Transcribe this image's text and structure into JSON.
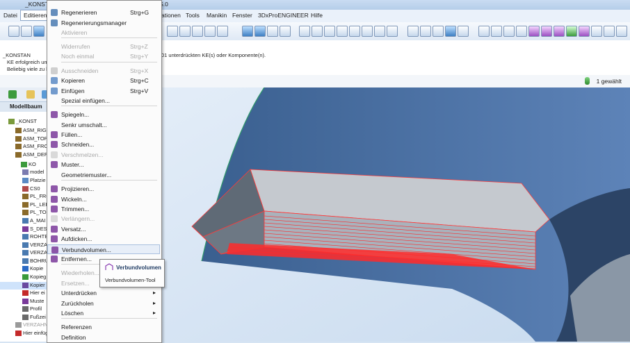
{
  "window": {
    "title": "_KONST",
    "title_suffix": "5.0"
  },
  "menubar": {
    "items": [
      "Datei",
      "Editieren",
      "ationen",
      "Tools",
      "Manikin",
      "Fenster",
      "3DxProENGINEER",
      "Hilfe"
    ]
  },
  "messages": {
    "line1_prefix": "_KONSTAN",
    "line1_suffix": "01 unterdrückten KE(s) oder Komponente(n).",
    "line2": "KE erfolgreich umd",
    "line3": "Beliebig viele zu ko"
  },
  "status": {
    "selected": "1 gewählt"
  },
  "model_tree": {
    "title": "Modellbaum",
    "rows": [
      "_KONST",
      "ASM_RIGH",
      "ASM_TOP",
      "ASM_FROI",
      "ASM_DEF_",
      "KO",
      "model",
      "Platzie",
      "CS0",
      "PL_FRO",
      "PL_LEF",
      "PL_TO",
      "A_MAI",
      "S_DESI",
      "ROHTE",
      "VERZA",
      "VERZA",
      "BOHRU",
      "Kopie",
      "Kopieg",
      "Kopier",
      "Hier ei",
      "Muste",
      "Profil",
      "Fußzei",
      "VERZAHN",
      "Hier einfüg"
    ]
  },
  "edit_menu": {
    "items": [
      {
        "label": "Regenerieren",
        "shortcut": "Strg+G",
        "disabled": false
      },
      {
        "label": "Regenerierungsmanager",
        "shortcut": "",
        "disabled": false
      },
      {
        "label": "Aktivieren",
        "shortcut": "",
        "disabled": true
      },
      {
        "label": "Widerrufen",
        "shortcut": "Strg+Z",
        "disabled": true
      },
      {
        "label": "Noch einmal",
        "shortcut": "Strg+Y",
        "disabled": true
      },
      {
        "label": "Ausschneiden",
        "shortcut": "Strg+X",
        "disabled": true
      },
      {
        "label": "Kopieren",
        "shortcut": "Strg+C",
        "disabled": false
      },
      {
        "label": "Einfügen",
        "shortcut": "Strg+V",
        "disabled": false
      },
      {
        "label": "Spezial einfügen...",
        "shortcut": "",
        "disabled": false
      },
      {
        "label": "Spiegeln...",
        "shortcut": "",
        "disabled": false
      },
      {
        "label": "Senkr umschalt...",
        "shortcut": "",
        "disabled": false
      },
      {
        "label": "Füllen...",
        "shortcut": "",
        "disabled": false
      },
      {
        "label": "Schneiden...",
        "shortcut": "",
        "disabled": false
      },
      {
        "label": "Verschmelzen...",
        "shortcut": "",
        "disabled": true
      },
      {
        "label": "Muster...",
        "shortcut": "",
        "disabled": false
      },
      {
        "label": "Geometriemuster...",
        "shortcut": "",
        "disabled": false
      },
      {
        "label": "Projizieren...",
        "shortcut": "",
        "disabled": false
      },
      {
        "label": "Wickeln...",
        "shortcut": "",
        "disabled": false
      },
      {
        "label": "Trimmen...",
        "shortcut": "",
        "disabled": false
      },
      {
        "label": "Verlängern...",
        "shortcut": "",
        "disabled": true
      },
      {
        "label": "Versatz...",
        "shortcut": "",
        "disabled": false
      },
      {
        "label": "Aufdicken...",
        "shortcut": "",
        "disabled": false
      },
      {
        "label": "Verbundvolumen...",
        "shortcut": "",
        "disabled": false,
        "highlighted": true
      },
      {
        "label": "Entfernen...",
        "shortcut": "",
        "disabled": false
      },
      {
        "label": "Wiederholen...",
        "shortcut": "",
        "disabled": true
      },
      {
        "label": "Ersetzen...",
        "shortcut": "",
        "disabled": true
      },
      {
        "label": "Unterdrücken",
        "shortcut": "",
        "disabled": false,
        "submenu": true
      },
      {
        "label": "Zurückholen",
        "shortcut": "",
        "disabled": false,
        "submenu": true
      },
      {
        "label": "Löschen",
        "shortcut": "",
        "disabled": false,
        "submenu": true
      },
      {
        "label": "Referenzen",
        "shortcut": "",
        "disabled": false
      },
      {
        "label": "Definition",
        "shortcut": "",
        "disabled": false
      }
    ]
  },
  "tooltip": {
    "title": "Verbundvolumen",
    "description": "Verbundvolumen-Tool"
  },
  "colors": {
    "accent": "#3d7fc4",
    "highlight_edges": "#ff2a2a",
    "viewport_bg": "#d6e4f3"
  }
}
